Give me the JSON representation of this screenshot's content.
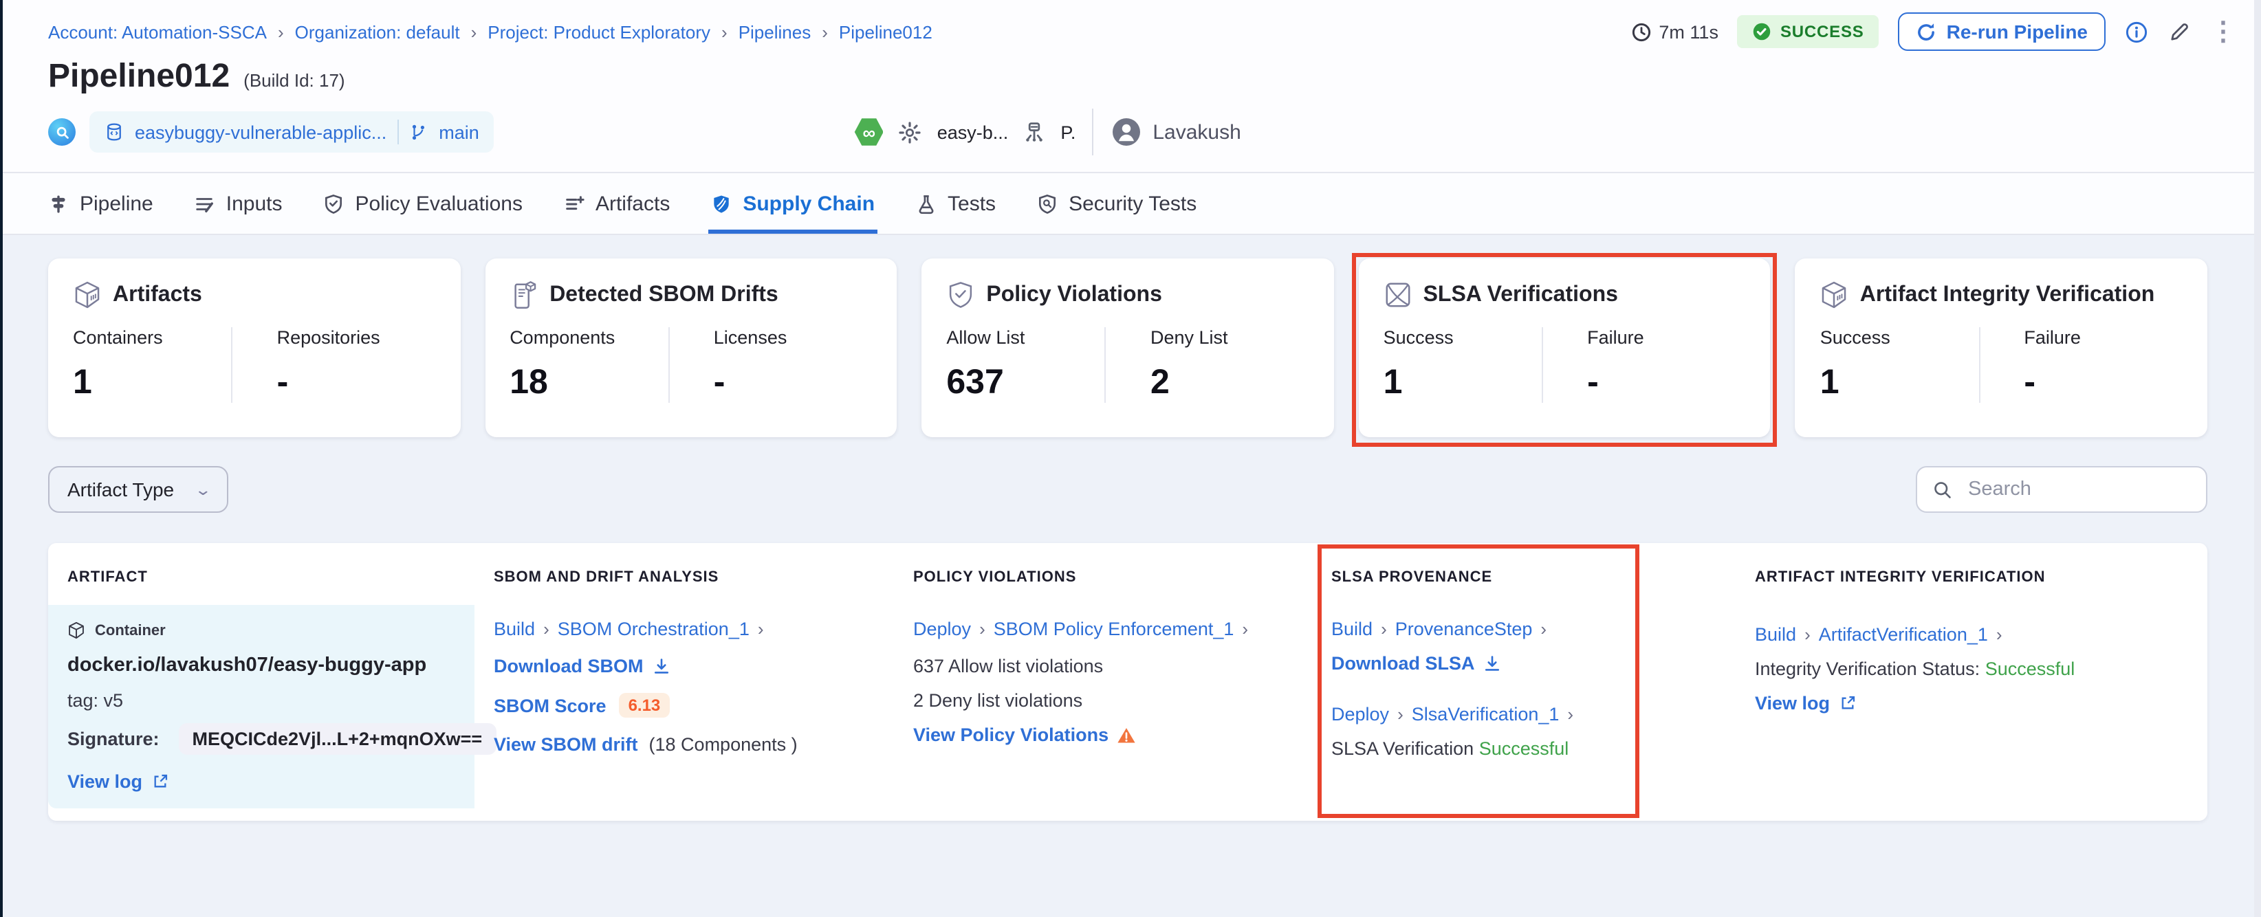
{
  "breadcrumb": {
    "items": [
      "Account: Automation-SSCA",
      "Organization: default",
      "Project: Product Exploratory",
      "Pipelines",
      "Pipeline012"
    ]
  },
  "header": {
    "duration": "7m 11s",
    "status": "SUCCESS",
    "rerun_label": "Re-run Pipeline",
    "title": "Pipeline012",
    "build_id": "(Build Id: 17)",
    "repo": "easybuggy-vulnerable-applic...",
    "branch": "main",
    "trigger_name": "easy-b...",
    "trigger_initial": "P.",
    "user": "Lavakush"
  },
  "tabs": [
    {
      "label": "Pipeline"
    },
    {
      "label": "Inputs"
    },
    {
      "label": "Policy Evaluations"
    },
    {
      "label": "Artifacts"
    },
    {
      "label": "Supply Chain",
      "active": true
    },
    {
      "label": "Tests"
    },
    {
      "label": "Security Tests"
    }
  ],
  "cards": [
    {
      "title": "Artifacts",
      "stats": [
        {
          "label": "Containers",
          "value": "1"
        },
        {
          "label": "Repositories",
          "value": "-"
        }
      ]
    },
    {
      "title": "Detected SBOM Drifts",
      "stats": [
        {
          "label": "Components",
          "value": "18"
        },
        {
          "label": "Licenses",
          "value": "-"
        }
      ]
    },
    {
      "title": "Policy Violations",
      "stats": [
        {
          "label": "Allow List",
          "value": "637"
        },
        {
          "label": "Deny List",
          "value": "2"
        }
      ]
    },
    {
      "title": "SLSA Verifications",
      "highlighted": true,
      "stats": [
        {
          "label": "Success",
          "value": "1"
        },
        {
          "label": "Failure",
          "value": "-"
        }
      ]
    },
    {
      "title": "Artifact Integrity Verification",
      "stats": [
        {
          "label": "Success",
          "value": "1"
        },
        {
          "label": "Failure",
          "value": "-"
        }
      ]
    }
  ],
  "filters": {
    "artifact_type_label": "Artifact Type",
    "search_placeholder": "Search"
  },
  "table": {
    "columns": [
      "ARTIFACT",
      "SBOM AND DRIFT ANALYSIS",
      "POLICY VIOLATIONS",
      "SLSA PROVENANCE",
      "ARTIFACT INTEGRITY VERIFICATION"
    ],
    "row": {
      "artifact": {
        "type_label": "Container",
        "image": "docker.io/lavakush07/easy-buggy-app",
        "tag": "tag: v5",
        "signature_label": "Signature:",
        "signature": "MEQCICde2Vjl...L+2+mqnOXw==",
        "view_log": "View log"
      },
      "sbom": {
        "stage": "Build",
        "step": "SBOM Orchestration_1",
        "download": "Download SBOM",
        "score_label": "SBOM Score",
        "score": "6.13",
        "drift_link": "View SBOM drift",
        "drift_detail": "(18 Components )"
      },
      "policy": {
        "stage": "Deploy",
        "step": "SBOM Policy Enforcement_1",
        "allow": "637 Allow list violations",
        "deny": "2 Deny list violations",
        "view": "View Policy Violations"
      },
      "slsa": {
        "stage1": "Build",
        "step1": "ProvenanceStep",
        "download": "Download SLSA",
        "stage2": "Deploy",
        "step2": "SlsaVerification_1",
        "status_label": "SLSA Verification",
        "status": "Successful"
      },
      "integrity": {
        "stage": "Build",
        "step": "ArtifactVerification_1",
        "status_label": "Integrity Verification Status:",
        "status": "Successful",
        "view_log": "View log"
      }
    }
  },
  "colors": {
    "link_blue": "#2f6fd6",
    "success_green": "#3fa24a",
    "badge_green_bg": "#e3f7e2",
    "annotation_red": "#e8432d",
    "warning_orange": "#f2753e",
    "score_orange": "#f45c2c"
  }
}
